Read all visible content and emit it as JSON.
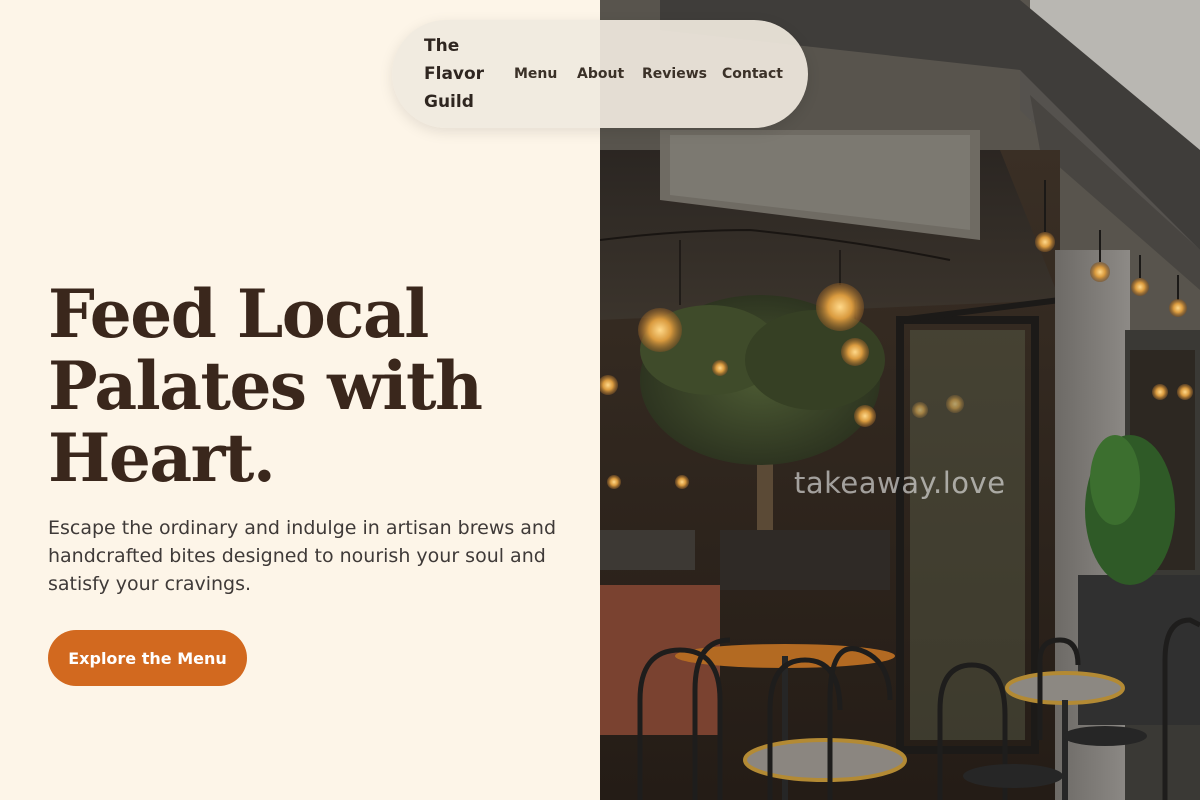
{
  "nav": {
    "brand": "The Flavor Guild",
    "links": [
      "Menu",
      "About",
      "Reviews",
      "Contact"
    ]
  },
  "hero": {
    "title": "Feed Local\nPalates with\nHeart.",
    "subtitle": "Escape the ordinary and indulge in artisan brews and handcrafted bites designed to nourish your soul and satisfy your cravings.",
    "cta_label": "Explore the Menu"
  },
  "photo": {
    "watermark": "takeaway.love"
  },
  "colors": {
    "background": "#fdf5e8",
    "heading": "#3a271c",
    "accent": "#d2691f",
    "nav_bg": "#f0e9de"
  }
}
